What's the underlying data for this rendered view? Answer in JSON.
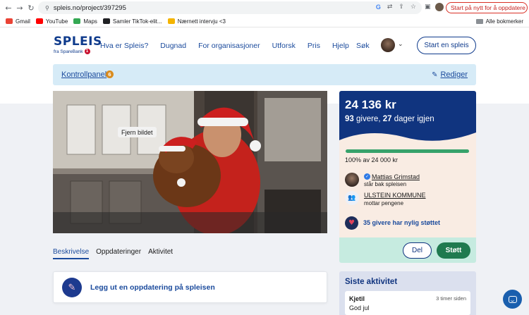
{
  "browser": {
    "url": "spleis.no/project/397295",
    "update_button": "Start på nytt for å oppdatere",
    "google_letter": "G"
  },
  "bookmarks": {
    "items": [
      {
        "label": "Gmail",
        "color": "#ea4335"
      },
      {
        "label": "YouTube",
        "color": "#ff0000"
      },
      {
        "label": "Maps",
        "color": "#34a853"
      },
      {
        "label": "Samler TikTok-elit...",
        "color": "#202124"
      },
      {
        "label": "Nærnett intervju <3",
        "color": "#f4b400"
      }
    ],
    "all_label": "Alle bokmerker"
  },
  "header": {
    "logo_text": "SPLEIS",
    "logo_sub": "fra SpareBank",
    "logo_badge": "1",
    "nav": [
      "Hva er Spleis?",
      "Dugnad",
      "For organisasjoner",
      "Utforsk",
      "Pris",
      "Hjelp"
    ],
    "search_label": "Søk",
    "start_button": "Start en spleis"
  },
  "kontrollpanel": {
    "label": "Kontrollpanel",
    "badge": "6",
    "edit_label": "Rediger"
  },
  "photo": {
    "remove_button": "Fjern bildet"
  },
  "donation": {
    "amount": "24 136 kr",
    "givers_count": "93",
    "givers_word": " givere, ",
    "days_count": "27",
    "days_word": " dager igjen",
    "progress_fraction": 1.0,
    "progress_text": "100% av 24 000 kr",
    "person_name": "Mattias Grimstad",
    "person_role": "står bak spleisen",
    "org_name": "ULSTEIN KOMMUNE",
    "org_role": "mottar pengene",
    "recent_link": "35 givere har nylig støttet",
    "del_button": "Del",
    "support_button": "Støtt",
    "colors": {
      "brand": "#10347f",
      "accent_green": "#1f7a4f",
      "progress": "#37a26b"
    }
  },
  "tabs": [
    "Beskrivelse",
    "Oppdateringer",
    "Aktivitet"
  ],
  "update_card": {
    "text": "Legg ut en oppdatering på spleisen"
  },
  "activity": {
    "title": "Siste aktivitet",
    "items": [
      {
        "name": "Kjetil",
        "time": "3 timer siden",
        "message": "God jul"
      }
    ]
  }
}
